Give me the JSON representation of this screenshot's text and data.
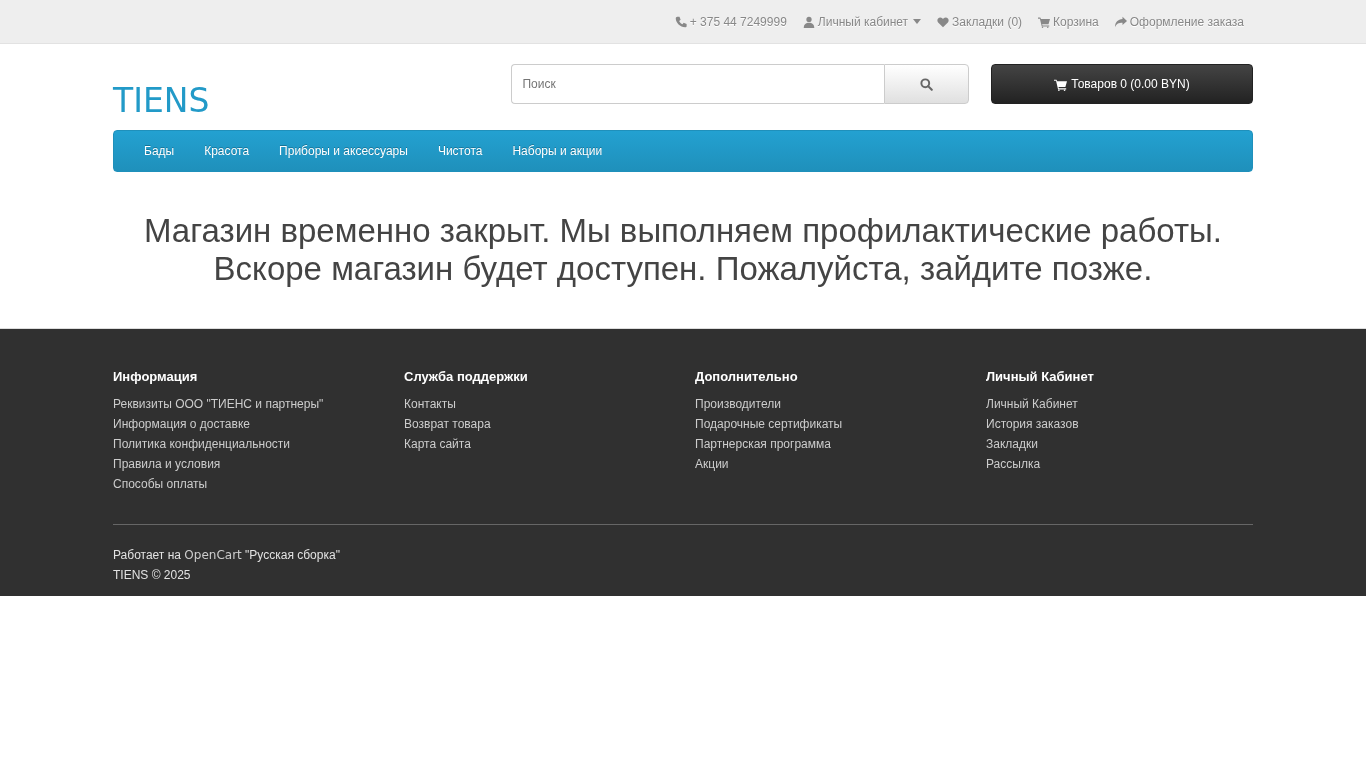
{
  "top_bar": [
    {
      "kind": "phone",
      "label": "+ 375 44 7249999",
      "dropdown": false
    },
    {
      "kind": "account",
      "label": "Личный кабинет",
      "dropdown": true
    },
    {
      "kind": "wishlist",
      "label": "Закладки (0)",
      "dropdown": false
    },
    {
      "kind": "cart",
      "label": "Корзина",
      "dropdown": false
    },
    {
      "kind": "checkout",
      "label": "Оформление заказа",
      "dropdown": false
    }
  ],
  "logo": "TIENS",
  "search": {
    "placeholder": "Поиск"
  },
  "cart_button": "Товаров 0 (0.00 BYN)",
  "menu": [
    "Бады",
    "Красота",
    "Приборы и аксессуары",
    "Чистота",
    "Наборы и акции"
  ],
  "message": "Магазин временно закрыт. Мы выполняем профилактические работы. Вскоре магазин будет доступен. Пожалуйста, зайдите позже.",
  "footer": {
    "columns": [
      {
        "title": "Информация",
        "links": [
          "Реквизиты ООО \"ТИЕНС и партнеры\"",
          "Информация о доставке",
          "Политика конфиденциальности",
          "Правила и условия",
          "Способы оплаты"
        ]
      },
      {
        "title": "Служба поддержки",
        "links": [
          "Контакты",
          "Возврат товара",
          "Карта сайта"
        ]
      },
      {
        "title": "Дополнительно",
        "links": [
          "Производители",
          "Подарочные сертификаты",
          "Партнерская программа",
          "Акции"
        ]
      },
      {
        "title": "Личный Кабинет",
        "links": [
          "Личный Кабинет",
          "История заказов",
          "Закладки",
          "Рассылка"
        ]
      }
    ],
    "powered": {
      "prefix": "Работает на",
      "link": "OpenCart",
      "suffix": "\"Русская сборка\""
    },
    "copyright": "TIENS © 2025"
  }
}
